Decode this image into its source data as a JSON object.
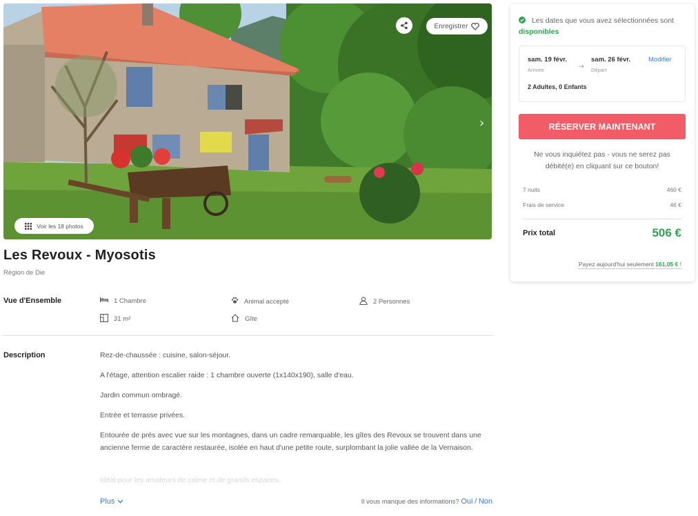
{
  "gallery": {
    "save_label": "Enregistrer",
    "photos_label": "Voir les 18 photos",
    "share_icon": "share-icon",
    "heart_icon": "heart-icon",
    "next_icon": "chevron-right-icon",
    "grid_icon": "grid-icon"
  },
  "listing": {
    "title": "Les Revoux - Myosotis",
    "region": "Région de Die"
  },
  "overview": {
    "label": "Vue d'Ensemble",
    "features": [
      {
        "icon": "bed-icon",
        "text": "1 Chambre"
      },
      {
        "icon": "paw-icon",
        "text": "Animal accepté"
      },
      {
        "icon": "person-icon",
        "text": "2 Personnes"
      },
      {
        "icon": "floor-plan-icon",
        "text": "31 m²"
      },
      {
        "icon": "house-icon",
        "text": "Gîte"
      }
    ]
  },
  "description": {
    "label": "Description",
    "paragraphs": [
      "Rez-de-chaussée : cuisine, salon-séjour.",
      "A l'étage, attention escalier raide : 1 chambre ouverte (1x140x190), salle d'eau.",
      "Jardin commun ombragé.",
      "Entrée et terrasse privées.",
      "Entourée de prés avec vue sur les montagnes, dans un cadre remarquable, les gîtes des Revoux se trouvent dans une ancienne ferme de caractère restaurée, isolée en haut d'une petite route, surplombant la jolie vallée de la Vernaison.",
      "Idéal pour les amateurs de calme et de grands espaces."
    ],
    "more_label": "Plus",
    "missing_info": "Il vous manque des informations?",
    "yes_label": "Oui",
    "separator": "/",
    "no_label": "Non"
  },
  "booking": {
    "availability_text": "Les dates que vous avez sélectionnées sont",
    "availability_status": "disponibles",
    "arrival_date": "sam. 19 févr.",
    "arrival_label": "Arrivée",
    "departure_date": "sam. 26 févr.",
    "departure_label": "Départ",
    "modify_label": "Modifier",
    "guests": "2 Adultes, 0 Enfants",
    "book_button": "RÉSERVER MAINTENANT",
    "reassurance": "Ne vous inquiétez pas - vous ne serez pas débité(e) en cliquant sur ce bouton!",
    "lines": [
      {
        "label": "7 nuits",
        "value": "460 €"
      },
      {
        "label": "Frais de service",
        "value": "46 €"
      }
    ],
    "total_label": "Prix total",
    "total_value": "506 €",
    "pay_today_prefix": "Payez aujourd'hui seulement",
    "pay_today_amount": "161,05 €",
    "pay_today_suffix": "!"
  },
  "colors": {
    "accent_button": "#f25c66",
    "available_green": "#2ea44f",
    "link_blue": "#3a7bd5"
  }
}
